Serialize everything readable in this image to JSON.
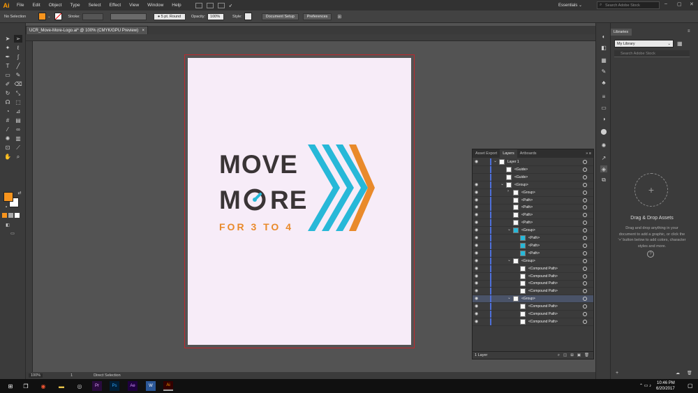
{
  "menu": {
    "logo": "Ai",
    "items": [
      "File",
      "Edit",
      "Object",
      "Type",
      "Select",
      "Effect",
      "View",
      "Window",
      "Help"
    ],
    "workspace": "Essentials",
    "stock_search_placeholder": "Search Adobe Stock"
  },
  "control": {
    "selection": "No Selection",
    "fill_color": "#f7941d",
    "stroke_label": "Stroke:",
    "brush": "5 pt. Round",
    "opacity_label": "Opacity:",
    "opacity_value": "100%",
    "style_label": "Style:",
    "document_setup": "Document Setup",
    "preferences": "Preferences"
  },
  "document": {
    "tab_title": "UCR_Move-More-Logo.ai* @ 100% (CMYK/GPU Preview)",
    "close": "×"
  },
  "logo": {
    "line1": "MOVE",
    "line2": "M",
    "line2_end": "RE",
    "tagline": "FOR 3 TO 4",
    "dark": "#3a3436",
    "orange": "#e98a2b",
    "cyan": "#27b8d8"
  },
  "status": {
    "zoom": "100%",
    "artboard": "1",
    "tool": "Direct Selection"
  },
  "layers": {
    "tabs": [
      "Asset Export",
      "Layers",
      "Artboards"
    ],
    "footer": "1 Layer",
    "rows": [
      {
        "name": "Layer 1",
        "indent": 0,
        "eye": true,
        "tw": "v",
        "thumb": "w"
      },
      {
        "name": "<Guide>",
        "indent": 1,
        "eye": false,
        "tw": "",
        "thumb": "w"
      },
      {
        "name": "<Guide>",
        "indent": 1,
        "eye": false,
        "tw": "",
        "thumb": "w"
      },
      {
        "name": "<Group>",
        "indent": 1,
        "eye": true,
        "tw": "v",
        "thumb": "w"
      },
      {
        "name": "<Group>",
        "indent": 2,
        "eye": true,
        "tw": ">",
        "thumb": "w"
      },
      {
        "name": "<Path>",
        "indent": 2,
        "eye": true,
        "tw": "",
        "thumb": "w"
      },
      {
        "name": "<Path>",
        "indent": 2,
        "eye": true,
        "tw": "",
        "thumb": "w"
      },
      {
        "name": "<Path>",
        "indent": 2,
        "eye": true,
        "tw": "",
        "thumb": "w"
      },
      {
        "name": "<Path>",
        "indent": 2,
        "eye": true,
        "tw": "",
        "thumb": "w"
      },
      {
        "name": "<Group>",
        "indent": 2,
        "eye": true,
        "tw": "v",
        "thumb": "c"
      },
      {
        "name": "<Path>",
        "indent": 3,
        "eye": true,
        "tw": "",
        "thumb": "c"
      },
      {
        "name": "<Path>",
        "indent": 3,
        "eye": true,
        "tw": "",
        "thumb": "c"
      },
      {
        "name": "<Path>",
        "indent": 3,
        "eye": true,
        "tw": "",
        "thumb": "c"
      },
      {
        "name": "<Group>",
        "indent": 2,
        "eye": true,
        "tw": "v",
        "thumb": "w"
      },
      {
        "name": "<Compound Path>",
        "indent": 3,
        "eye": true,
        "tw": "",
        "thumb": "w"
      },
      {
        "name": "<Compound Path>",
        "indent": 3,
        "eye": true,
        "tw": "",
        "thumb": "w"
      },
      {
        "name": "<Compound Path>",
        "indent": 3,
        "eye": true,
        "tw": "",
        "thumb": "w"
      },
      {
        "name": "<Compound Path>",
        "indent": 3,
        "eye": true,
        "tw": "",
        "thumb": "w"
      },
      {
        "name": "<Group>",
        "indent": 2,
        "eye": true,
        "tw": "v",
        "thumb": "w",
        "selected": true
      },
      {
        "name": "<Compound Path>",
        "indent": 3,
        "eye": true,
        "tw": "",
        "thumb": "w"
      },
      {
        "name": "<Compound Path>",
        "indent": 3,
        "eye": true,
        "tw": "",
        "thumb": "w"
      },
      {
        "name": "<Compound Path>",
        "indent": 3,
        "eye": true,
        "tw": "",
        "thumb": "w"
      }
    ]
  },
  "libraries": {
    "tab": "Libraries",
    "selected": "My Library",
    "search_placeholder": "Search Adobe Stock",
    "dd_plus": "+",
    "dd_title": "Drag & Drop Assets",
    "dd_desc": "Drag and drop anything in your document to add a graphic, or click the '+' button below to add colors, character styles and more.",
    "dd_help": "?"
  },
  "taskbar": {
    "time": "10:46 PM",
    "date": "6/20/2017"
  }
}
